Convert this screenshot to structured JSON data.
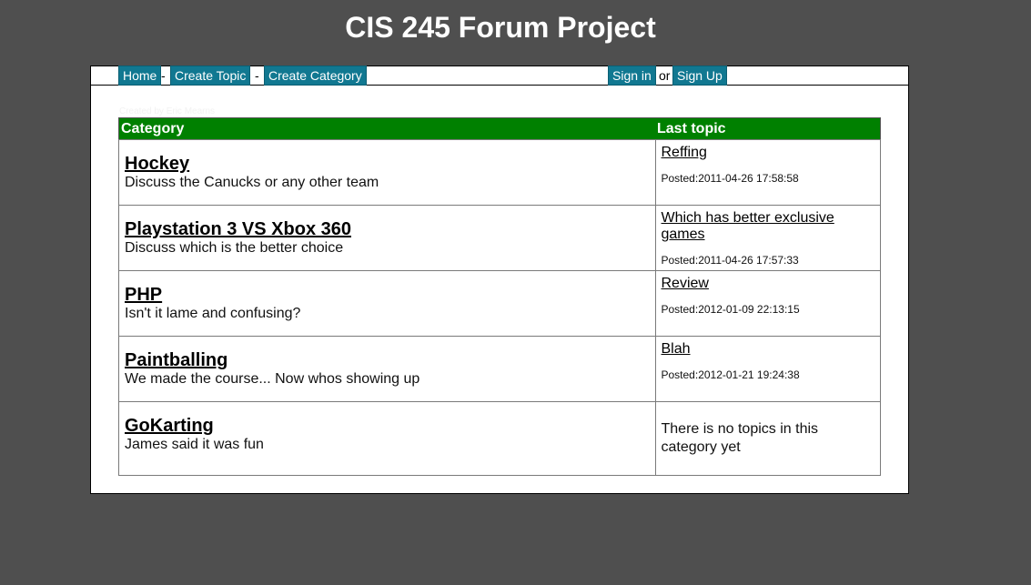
{
  "header": {
    "title": "CIS 245 Forum Project"
  },
  "nav": {
    "home": "Home",
    "sep1": "-",
    "create_topic": "Create Topic",
    "sep2": "-",
    "create_category": "Create Category",
    "sign_in": "Sign in",
    "or": "or",
    "sign_up": "Sign Up"
  },
  "credit": "Created by Eric Mearns",
  "table": {
    "headers": [
      "Category",
      "Last topic"
    ],
    "rows": [
      {
        "name": "Hockey",
        "description": "Discuss the Canucks or any other team",
        "last_topic": "Reffing",
        "posted": "Posted:2011-04-26 17:58:58"
      },
      {
        "name": "Playstation 3 VS Xbox 360",
        "description": "Discuss which is the better choice",
        "last_topic": "Which has better exclusive games",
        "posted": "Posted:2011-04-26 17:57:33"
      },
      {
        "name": "PHP",
        "description": "Isn't it lame and confusing?",
        "last_topic": "Review",
        "posted": "Posted:2012-01-09 22:13:15"
      },
      {
        "name": "Paintballing",
        "description": "We made the course... Now whos showing up",
        "last_topic": "Blah",
        "posted": "Posted:2012-01-21 19:24:38"
      },
      {
        "name": "GoKarting",
        "description": "James said it was fun",
        "no_topics": "There is no topics in this category yet"
      }
    ]
  },
  "colors": {
    "background": "#4f4f4f",
    "nav_button": "#117891",
    "table_header": "#008000"
  }
}
